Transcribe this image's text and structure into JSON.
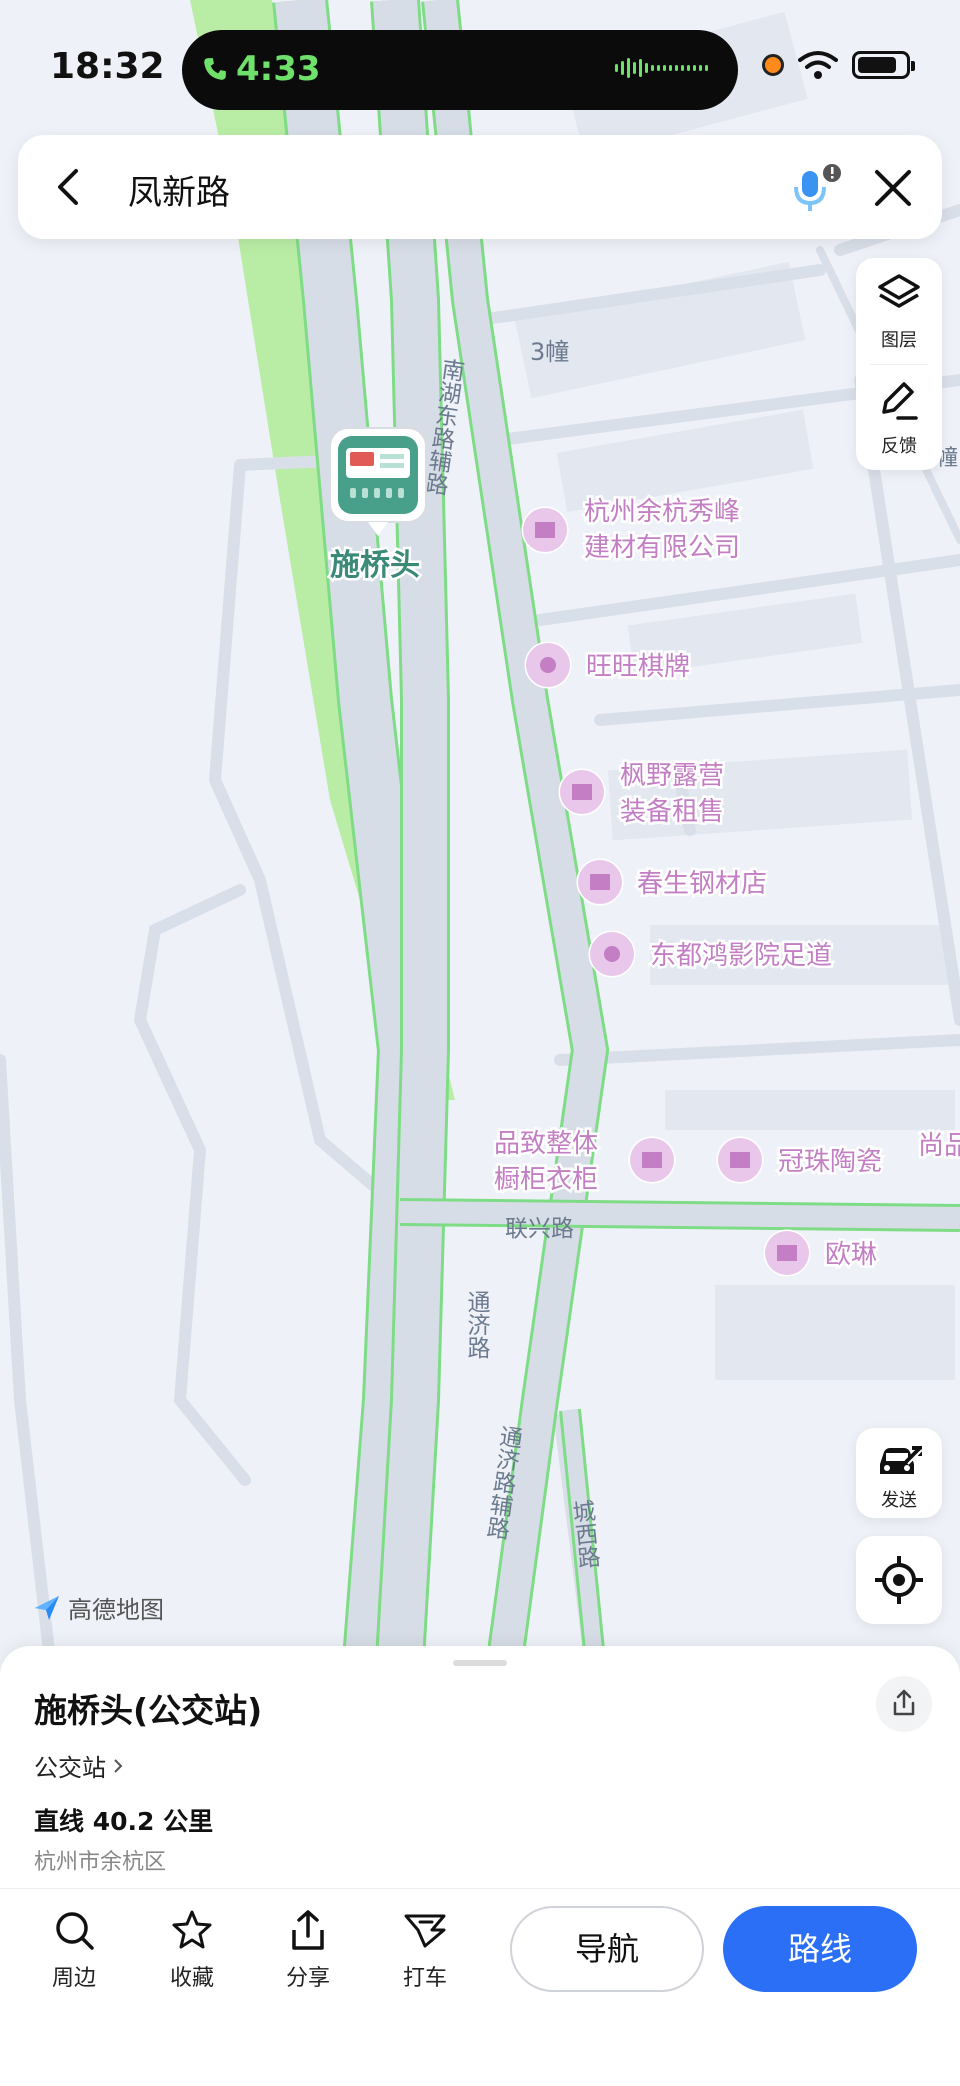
{
  "status_bar": {
    "time": "18:32",
    "call_timer": "4:33"
  },
  "search": {
    "query": "凤新路"
  },
  "map": {
    "road_labels": [
      {
        "key": "nanhu",
        "text": "南湖东路辅路"
      },
      {
        "key": "lianxing",
        "text": "联兴路"
      },
      {
        "key": "tongji",
        "text": "通济路"
      },
      {
        "key": "tongji_aux",
        "text": "通济路辅路"
      },
      {
        "key": "chengxi",
        "text": "城西路"
      }
    ],
    "building_label": "3幢",
    "edge_label": "幢",
    "selected_poi": "施桥头",
    "pois": [
      {
        "name_line1": "杭州余杭秀峰",
        "name_line2": "建材有限公司",
        "icon": "shop-icon"
      },
      {
        "name_line1": "旺旺棋牌",
        "icon": "pin-icon"
      },
      {
        "name_line1": "枫野露营",
        "name_line2": "装备租售",
        "icon": "shop-icon"
      },
      {
        "name_line1": "春生钢材店",
        "icon": "shop-icon"
      },
      {
        "name_line1": "东都鸿影院足道",
        "icon": "pin-icon"
      },
      {
        "name_line1": "品致整体",
        "name_line2": "橱柜衣柜",
        "icon": "shop-icon"
      },
      {
        "name_line1": "冠珠陶瓷",
        "icon": "shop-icon"
      },
      {
        "name_line1": "尚品",
        "icon": "shop-icon"
      },
      {
        "name_line1": "欧琳",
        "icon": "shop-icon"
      }
    ],
    "brand": "高德地图",
    "colors": {
      "road": "#d7dde6",
      "road_edge": "#7fdc86",
      "greenbelt": "#b9eda5",
      "poi": "#c37ec4",
      "label": "#6b7a8e"
    }
  },
  "side_panel": {
    "layers_label": "图层",
    "feedback_label": "反馈"
  },
  "send_button": {
    "label": "发送"
  },
  "detail": {
    "title": "施桥头(公交站)",
    "type": "公交站",
    "distance": "直线 40.2 公里",
    "district": "杭州市余杭区"
  },
  "actions": [
    {
      "label": "周边",
      "icon": "search-icon"
    },
    {
      "label": "收藏",
      "icon": "star-icon"
    },
    {
      "label": "分享",
      "icon": "share-icon"
    },
    {
      "label": "打车",
      "icon": "taxi-icon"
    }
  ],
  "nav_button": "导航",
  "route_button": "路线",
  "accent": "#2a6ff6"
}
